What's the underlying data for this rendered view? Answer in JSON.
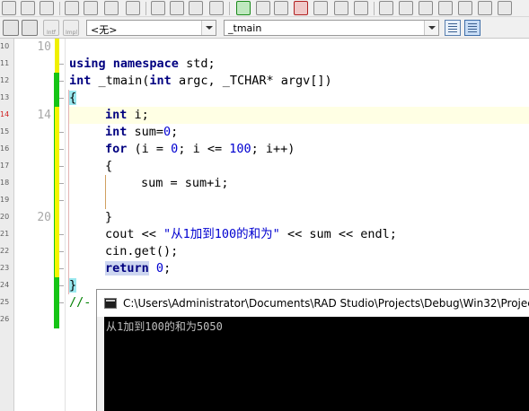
{
  "navbar": {
    "btn1_label": "Intf",
    "btn2_label": "Impl",
    "scope_combo_value": "<无>",
    "function_combo_value": "_tmain"
  },
  "editor": {
    "gutter_numbers": [
      "10",
      "11",
      "12",
      "13",
      "14",
      "15",
      "16",
      "17",
      "18",
      "19",
      "20",
      "21",
      "22",
      "23",
      "24",
      "25",
      "26"
    ],
    "big_numbers": {
      "line10": "10",
      "line14": "14",
      "line20": "20"
    },
    "lines": {
      "l11_kw1": "using",
      "l11_kw2": "namespace",
      "l11_rest": " std;",
      "l12_kw": "int",
      "l12_rest": " _tmain(",
      "l12_kw2": "int",
      "l12_rest2": " argc, _TCHAR* argv[])",
      "l13_brace": "{",
      "l14_kw": "int",
      "l14_rest": " i;",
      "l15_kw": "int",
      "l15_rest": " sum=",
      "l15_num": "0",
      "l15_end": ";",
      "l16_kw": "for",
      "l16_a": " (i = ",
      "l16_n1": "0",
      "l16_b": "; i <= ",
      "l16_n2": "100",
      "l16_c": "; i++)",
      "l17_brace": "{",
      "l18_text": "sum = sum+i;",
      "l20_brace": "}",
      "l21_a": "cout << ",
      "l21_str": "\"从1加到100的和为\"",
      "l21_b": " << sum << endl;",
      "l22_text": "cin.get();",
      "l23_kw": "return",
      "l23_sp": " ",
      "l23_num": "0",
      "l23_end": ";",
      "l24_brace": "}",
      "l25_comment": "//-"
    }
  },
  "console": {
    "title": "C:\\Users\\Administrator\\Documents\\RAD Studio\\Projects\\Debug\\Win32\\Projec",
    "output": "从1加到100的和为5050"
  }
}
